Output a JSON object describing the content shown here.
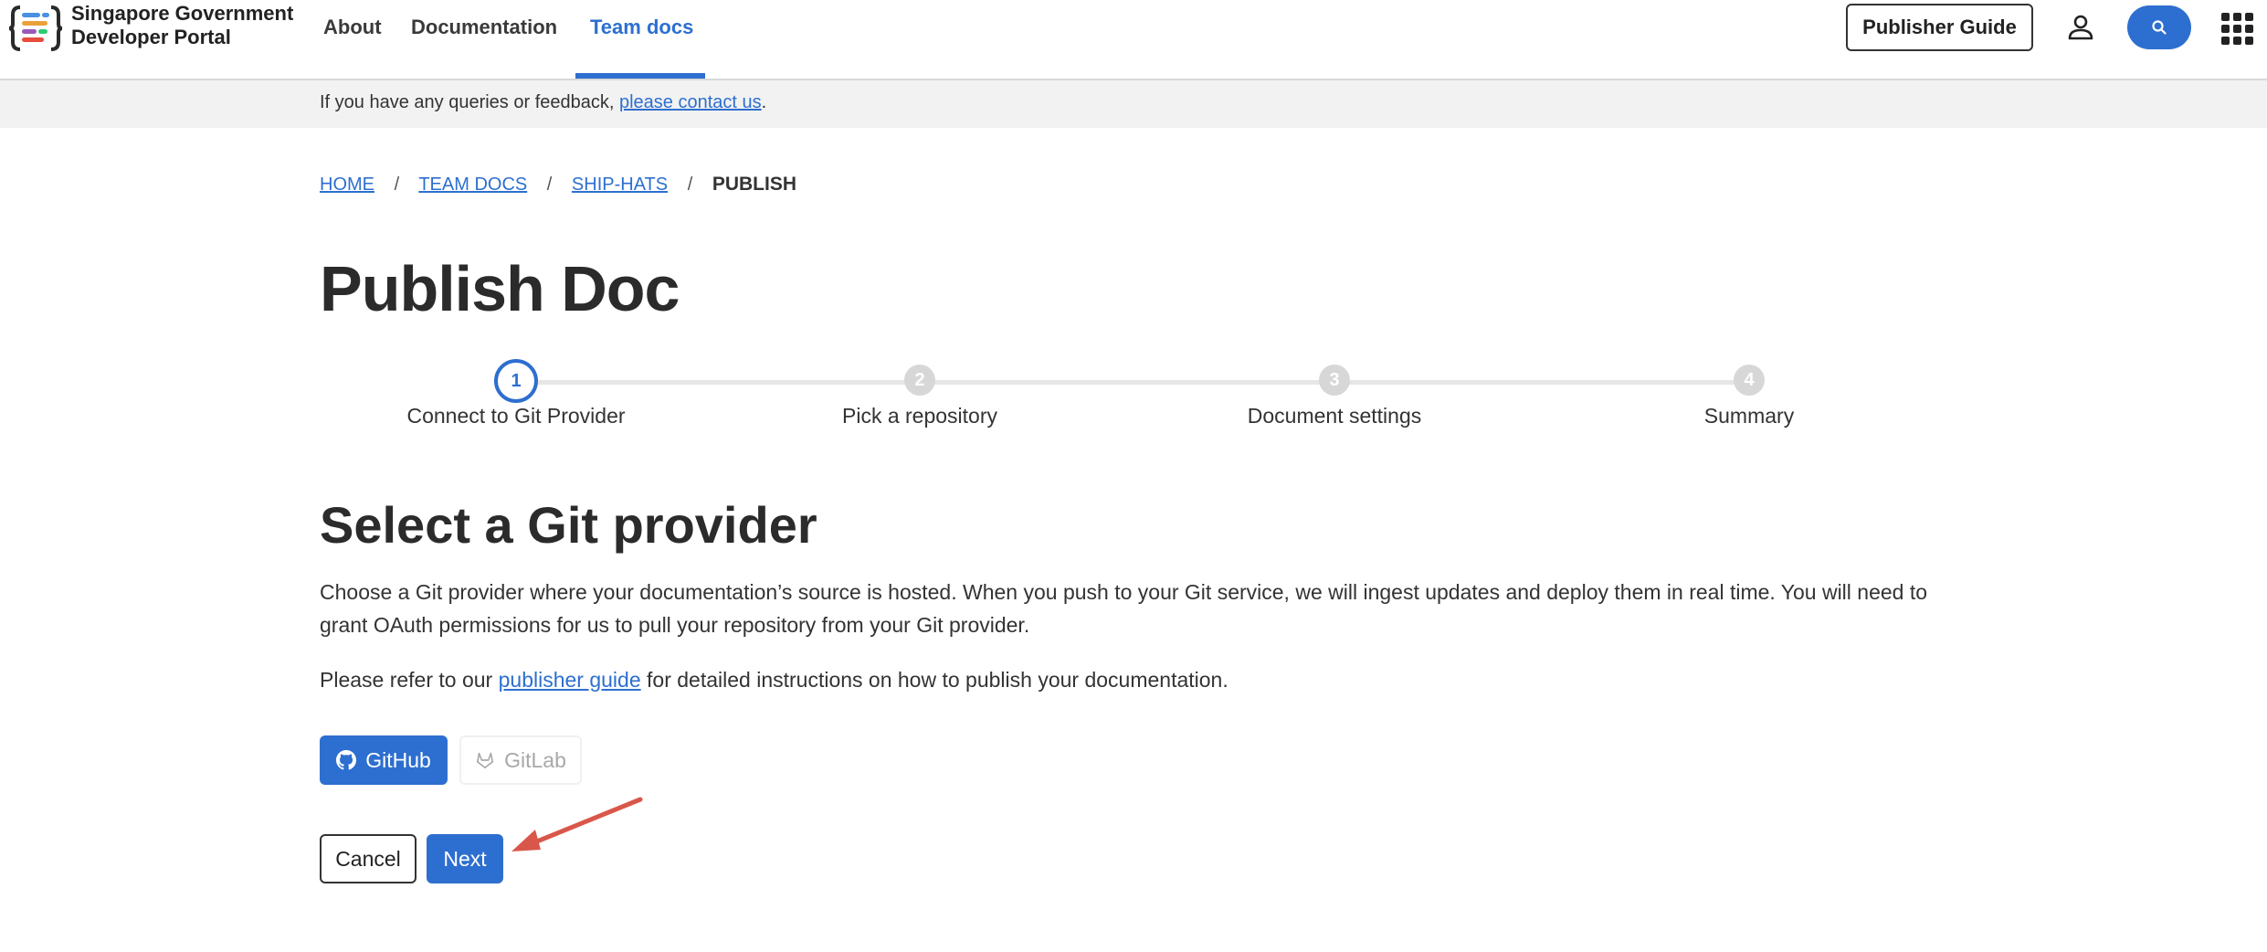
{
  "header": {
    "brand_line1": "Singapore Government",
    "brand_line2": "Developer Portal",
    "nav": [
      {
        "label": "About"
      },
      {
        "label": "Documentation"
      },
      {
        "label": "Team docs"
      }
    ],
    "publisher_guide_label": "Publisher Guide"
  },
  "feedback": {
    "text": "If you have any queries or feedback, ",
    "link": "please contact us",
    "end": "."
  },
  "breadcrumb": {
    "items": [
      "HOME",
      "TEAM DOCS",
      "SHIP-HATS"
    ],
    "current": "PUBLISH",
    "separator": "/"
  },
  "page_title": "Publish Doc",
  "stepper": {
    "steps": [
      {
        "number": "1",
        "label": "Connect to Git Provider",
        "state": "active"
      },
      {
        "number": "2",
        "label": "Pick a repository",
        "state": "inactive"
      },
      {
        "number": "3",
        "label": "Document settings",
        "state": "inactive"
      },
      {
        "number": "4",
        "label": "Summary",
        "state": "inactive"
      }
    ]
  },
  "section": {
    "title": "Select a Git provider",
    "paragraph1": "Choose a Git provider where your documentation’s source is hosted. When you push to your Git service, we will ingest updates and deploy them in real time. You will need to grant OAuth permissions for us to pull your repository from your Git provider.",
    "paragraph2_prefix": "Please refer to our ",
    "paragraph2_link": "publisher guide",
    "paragraph2_suffix": " for detailed instructions on how to publish your documentation."
  },
  "providers": {
    "github_label": "GitHub",
    "gitlab_label": "GitLab"
  },
  "actions": {
    "cancel_label": "Cancel",
    "next_label": "Next"
  },
  "colors": {
    "primary": "#2d6fd0",
    "annotation_arrow": "#d9574a"
  }
}
